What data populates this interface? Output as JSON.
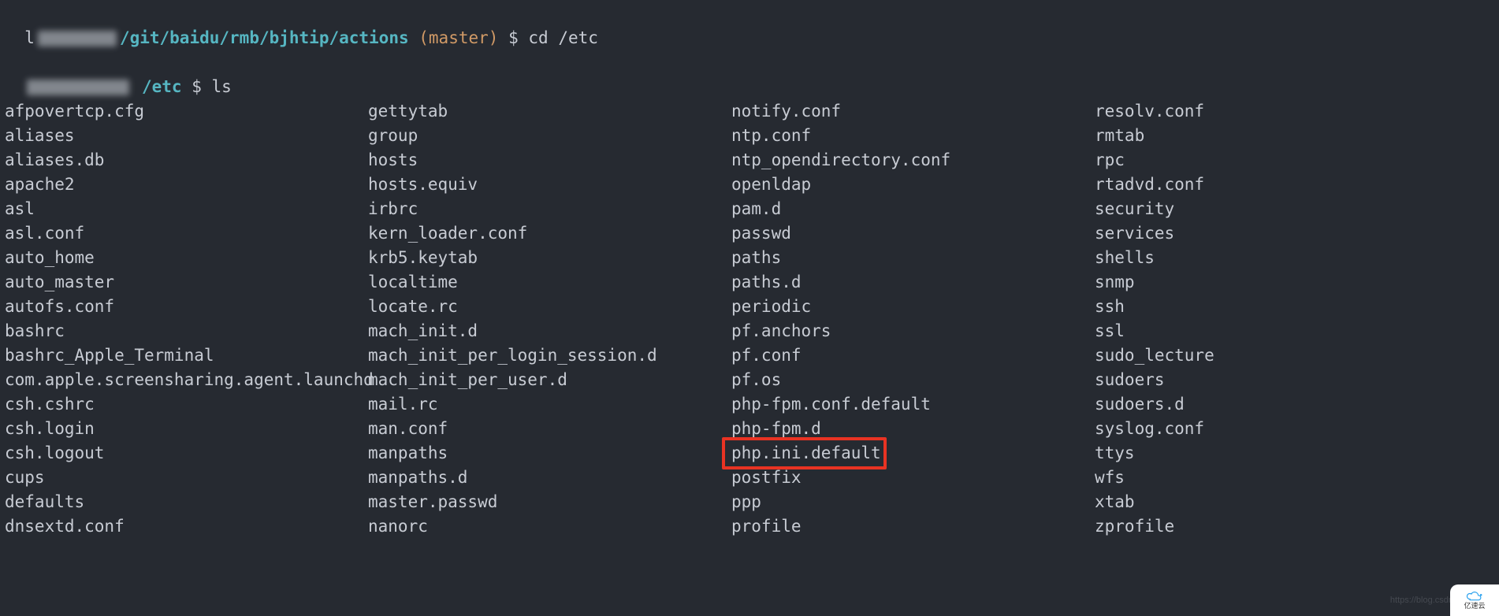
{
  "prompt1": {
    "user_prefix": "l",
    "path": "/git/baidu/rmb/bjhtip/actions",
    "branch": "(master)",
    "symbol": "$",
    "command": "cd /etc"
  },
  "prompt2": {
    "path": "/etc",
    "symbol": "$",
    "command": "ls"
  },
  "ls": {
    "col1": [
      "afpovertcp.cfg",
      "aliases",
      "aliases.db",
      "apache2",
      "asl",
      "asl.conf",
      "auto_home",
      "auto_master",
      "autofs.conf",
      "bashrc",
      "bashrc_Apple_Terminal",
      "com.apple.screensharing.agent.launchd",
      "csh.cshrc",
      "csh.login",
      "csh.logout",
      "cups",
      "defaults",
      "dnsextd.conf"
    ],
    "col2": [
      "gettytab",
      "group",
      "hosts",
      "hosts.equiv",
      "irbrc",
      "kern_loader.conf",
      "krb5.keytab",
      "localtime",
      "locate.rc",
      "mach_init.d",
      "mach_init_per_login_session.d",
      "mach_init_per_user.d",
      "mail.rc",
      "man.conf",
      "manpaths",
      "manpaths.d",
      "master.passwd",
      "nanorc"
    ],
    "col3": [
      "notify.conf",
      "ntp.conf",
      "ntp_opendirectory.conf",
      "openldap",
      "pam.d",
      "passwd",
      "paths",
      "paths.d",
      "periodic",
      "pf.anchors",
      "pf.conf",
      "pf.os",
      "php-fpm.conf.default",
      "php-fpm.d",
      "php.ini.default",
      "postfix",
      "ppp",
      "profile"
    ],
    "col4": [
      "resolv.conf",
      "rmtab",
      "rpc",
      "rtadvd.conf",
      "security",
      "services",
      "shells",
      "snmp",
      "ssh",
      "ssl",
      "sudo_lecture",
      "sudoers",
      "sudoers.d",
      "syslog.conf",
      "ttys",
      "wfs",
      "xtab",
      "zprofile"
    ],
    "highlighted": "php.ini.default"
  },
  "watermark": {
    "url": "https://blog.csdn",
    "brand": "亿速云"
  }
}
